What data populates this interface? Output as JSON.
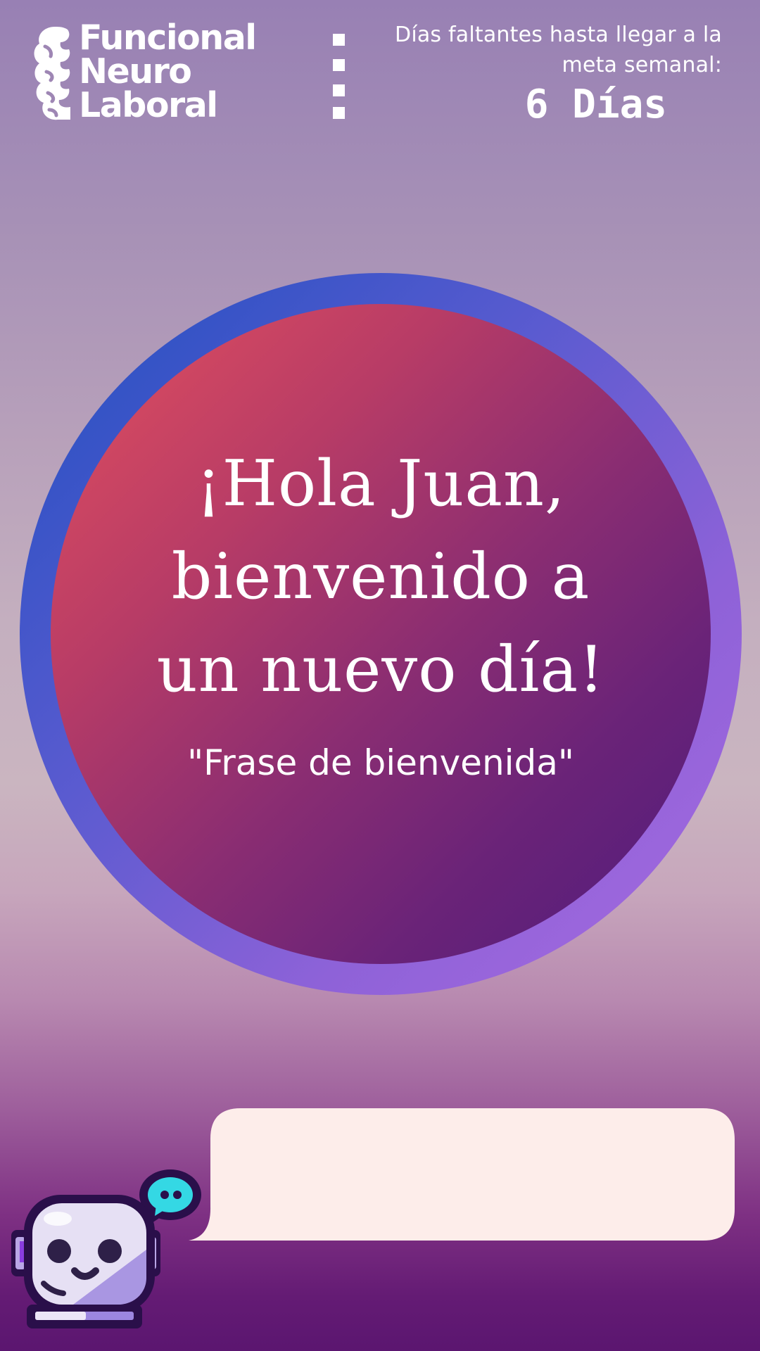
{
  "logo": {
    "line1": "Funcional",
    "line2": "Neuro",
    "line3": "Laboral",
    "icon": "brain-icon"
  },
  "menu": {
    "icon": "vertical-dots-menu-icon"
  },
  "counter": {
    "label": "Días faltantes hasta llegar a la meta semanal:",
    "value": "6 Días"
  },
  "welcome": {
    "greeting_line1": "¡Hola Juan,",
    "greeting_line2": "bienvenido a",
    "greeting_line3": "un nuevo día!",
    "phrase": "\"Frase de bienvenida\""
  },
  "assistant": {
    "icon": "robot-assistant-icon",
    "chat_icon": "chat-bubble-icon",
    "message": ""
  },
  "colors": {
    "ring_start": "#1f4fc0",
    "ring_end": "#a86ae0",
    "disc_start": "#e4505e",
    "disc_end": "#4f1c7c",
    "bubble": "#fdedea",
    "text": "#ffffff"
  }
}
